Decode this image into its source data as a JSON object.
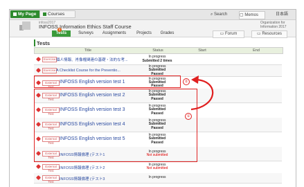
{
  "topbar": {
    "my_page": "My Page",
    "courses": "Courses",
    "search": "Search",
    "memos": "Memos",
    "lang": "日本語"
  },
  "course": {
    "code": "infoss2017",
    "title": "INFOSS Information Ethics Staff Course",
    "org": "Organization for Information 2017",
    "badge": "0"
  },
  "tabs": [
    "Tests",
    "Surveys",
    "Assignments",
    "Projects",
    "Grades"
  ],
  "tabs_right": [
    "Forum",
    "Resources"
  ],
  "section_title": "Tests",
  "table": {
    "headers": [
      "Title",
      "Status",
      "Start",
      "End"
    ],
    "rows": [
      {
        "tag": "Exercise",
        "title": "個人情報、肖像権関連の基礎・法的な考...",
        "status": [
          "In progress",
          "Submitted 2 times"
        ],
        "status_style": "normal"
      },
      {
        "tag": "Exercise",
        "title": "A Checklist Course for the Preventio...",
        "status": [
          "In progress",
          "Submitted",
          "Passed"
        ],
        "status_style": "normal"
      },
      {
        "tag": "External Test",
        "title": "INFOSS English version test 1",
        "status": [
          "In progress",
          "Submitted",
          "Passed"
        ],
        "status_style": "normal"
      },
      {
        "tag": "External Test",
        "title": "INFOSS English version test 2",
        "status": [
          "In progress",
          "Submitted",
          "Passed"
        ],
        "status_style": "normal"
      },
      {
        "tag": "External Test",
        "title": "INFOSS English version test 3",
        "status": [
          "In progress",
          "Submitted",
          "Passed"
        ],
        "status_style": "normal"
      },
      {
        "tag": "External Test",
        "title": "INFOSS English version test 4",
        "status": [
          "In progress",
          "Submitted",
          "Passed"
        ],
        "status_style": "normal"
      },
      {
        "tag": "External Test",
        "title": "INFOSS English version test 5",
        "status": [
          "In progress",
          "Submitted",
          "Passed"
        ],
        "status_style": "normal"
      },
      {
        "tag": "External Test",
        "title": "INFOSS情報倫理 (テスト1",
        "status": [
          "In progress",
          "Not submitted"
        ],
        "status_style": "notsub"
      },
      {
        "tag": "External Test",
        "title": "INFOSS情報倫理 (テスト2",
        "status": [
          "In progress",
          "Not submitted"
        ],
        "status_style": "notsub"
      },
      {
        "tag": "External Test",
        "title": "INFOSS情報倫理 (テスト3",
        "status": [
          "In progress"
        ],
        "status_style": "normal"
      }
    ]
  },
  "annotations": {
    "circle_1": "①",
    "circle_2": "②"
  },
  "colors": {
    "accent_green": "#2e8b2e",
    "annotation_red": "#e02020",
    "link_blue": "#2a4aa0"
  }
}
